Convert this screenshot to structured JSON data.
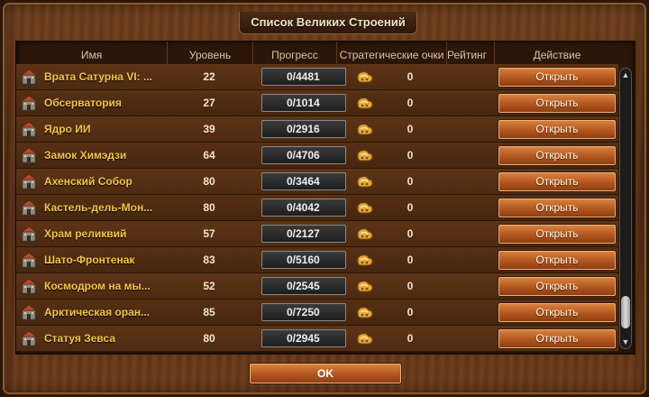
{
  "window": {
    "title": "Список Великих Строений"
  },
  "headers": {
    "name": "Имя",
    "level": "Уровень",
    "progress": "Прогресс",
    "strategy_points": "Стратегические очки",
    "rank": "Рейтинг",
    "action": "Действие"
  },
  "rows": [
    {
      "name": "Врата Сатурна VI: ...",
      "level": "22",
      "progress": "0/4481",
      "rank": "0",
      "action": "Открыть",
      "icon": "saturn-gate-icon"
    },
    {
      "name": "Обсерватория",
      "level": "27",
      "progress": "0/1014",
      "rank": "0",
      "action": "Открыть",
      "icon": "observatory-icon"
    },
    {
      "name": "Ядро ИИ",
      "level": "39",
      "progress": "0/2916",
      "rank": "0",
      "action": "Открыть",
      "icon": "ai-core-icon"
    },
    {
      "name": "Замок Химэдзи",
      "level": "64",
      "progress": "0/4706",
      "rank": "0",
      "action": "Открыть",
      "icon": "himeji-castle-icon"
    },
    {
      "name": "Ахенский Собор",
      "level": "80",
      "progress": "0/3464",
      "rank": "0",
      "action": "Открыть",
      "icon": "aachen-cathedral-icon"
    },
    {
      "name": "Кастель-дель-Мон...",
      "level": "80",
      "progress": "0/4042",
      "rank": "0",
      "action": "Открыть",
      "icon": "castel-del-monte-icon"
    },
    {
      "name": "Храм реликвий",
      "level": "57",
      "progress": "0/2127",
      "rank": "0",
      "action": "Открыть",
      "icon": "temple-of-relics-icon"
    },
    {
      "name": "Шато-Фронтенак",
      "level": "83",
      "progress": "0/5160",
      "rank": "0",
      "action": "Открыть",
      "icon": "chateau-frontenac-icon"
    },
    {
      "name": "Космодром на мы...",
      "level": "52",
      "progress": "0/2545",
      "rank": "0",
      "action": "Открыть",
      "icon": "spaceport-icon"
    },
    {
      "name": "Арктическая оран...",
      "level": "85",
      "progress": "0/7250",
      "rank": "0",
      "action": "Открыть",
      "icon": "arctic-orangery-icon"
    },
    {
      "name": "Статуя Зевса",
      "level": "80",
      "progress": "0/2945",
      "rank": "0",
      "action": "Открыть",
      "icon": "statue-of-zeus-icon"
    }
  ],
  "footer": {
    "ok_label": "OK"
  },
  "colors": {
    "name_text": "#f1c548",
    "button": "#c06a2a",
    "wood": "#5a3014"
  }
}
